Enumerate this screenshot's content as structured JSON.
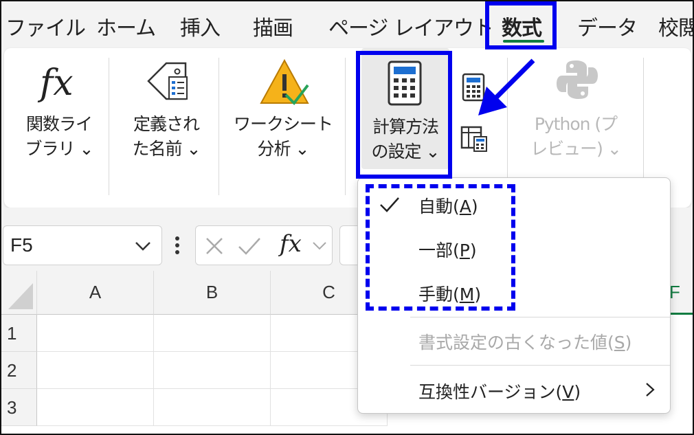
{
  "tabs": [
    "ファイル",
    "ホーム",
    "挿入",
    "描画",
    "ページ レイアウト",
    "数式",
    "データ",
    "校閲"
  ],
  "active_tab": "数式",
  "ribbon": {
    "function_library": {
      "line1": "関数ライ",
      "line2": "ブラリ ⌄"
    },
    "defined_names": {
      "line1": "定義され",
      "line2": "た名前 ⌄"
    },
    "formula_auditing": {
      "line1": "ワークシート",
      "line2": "分析 ⌄"
    },
    "calculation": {
      "line1": "計算方法",
      "line2": "の設定 ⌄"
    },
    "python": {
      "line1": "Python (プ",
      "line2": "レビュー) ⌄"
    }
  },
  "formula_bar": {
    "name_box": "F5",
    "fx_symbol": "fx"
  },
  "columns": [
    "A",
    "B",
    "C",
    "F"
  ],
  "rows": [
    "1",
    "2",
    "3"
  ],
  "menu": {
    "items": [
      {
        "label": "自動(",
        "key": "A",
        "suffix": ")",
        "checked": true,
        "disabled": false
      },
      {
        "label": "一部(",
        "key": "P",
        "suffix": ")",
        "checked": false,
        "disabled": false
      },
      {
        "label": "手動(",
        "key": "M",
        "suffix": ")",
        "checked": false,
        "disabled": false
      },
      {
        "label": "書式設定の古くなった値(",
        "key": "S",
        "suffix": ")",
        "checked": false,
        "disabled": true
      },
      {
        "label": "互換性バージョン(",
        "key": "V",
        "suffix": ")",
        "checked": false,
        "disabled": false,
        "submenu": true
      }
    ]
  },
  "colors": {
    "highlight": "#0000ee",
    "accent_green": "#107c41"
  }
}
